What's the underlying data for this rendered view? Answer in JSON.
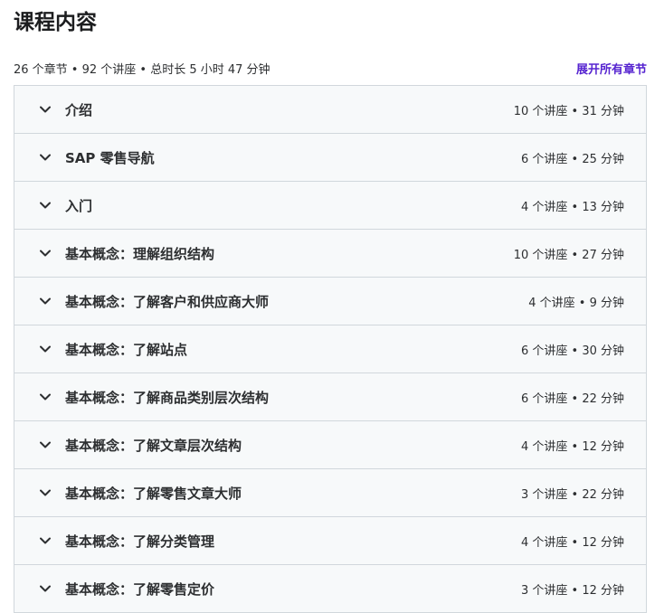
{
  "header": {
    "title": "课程内容",
    "summary": "26 个章节 • 92 个讲座 • 总时长 5 小时 47 分钟",
    "expand_all": "展开所有章节"
  },
  "sections": [
    {
      "title": "介绍",
      "meta": "10 个讲座 • 31 分钟"
    },
    {
      "title": "SAP 零售导航",
      "meta": "6 个讲座 • 25 分钟"
    },
    {
      "title": "入门",
      "meta": "4 个讲座 • 13 分钟"
    },
    {
      "title": "基本概念：理解组织结构",
      "meta": "10 个讲座 • 27 分钟"
    },
    {
      "title": "基本概念：了解客户和供应商大师",
      "meta": "4 个讲座 • 9 分钟"
    },
    {
      "title": "基本概念：了解站点",
      "meta": "6 个讲座 • 30 分钟"
    },
    {
      "title": "基本概念：了解商品类别层次结构",
      "meta": "6 个讲座 • 22 分钟"
    },
    {
      "title": "基本概念：了解文章层次结构",
      "meta": "4 个讲座 • 12 分钟"
    },
    {
      "title": "基本概念：了解零售文章大师",
      "meta": "3 个讲座 • 22 分钟"
    },
    {
      "title": "基本概念：了解分类管理",
      "meta": "4 个讲座 • 12 分钟"
    },
    {
      "title": "基本概念：了解零售定价",
      "meta": "3 个讲座 • 12 分钟"
    }
  ],
  "icons": {
    "section_toggle": "chevron-down-icon"
  },
  "colors": {
    "accent": "#5624d0",
    "panel": "#f7f9fa",
    "border": "#d1d7dc"
  }
}
